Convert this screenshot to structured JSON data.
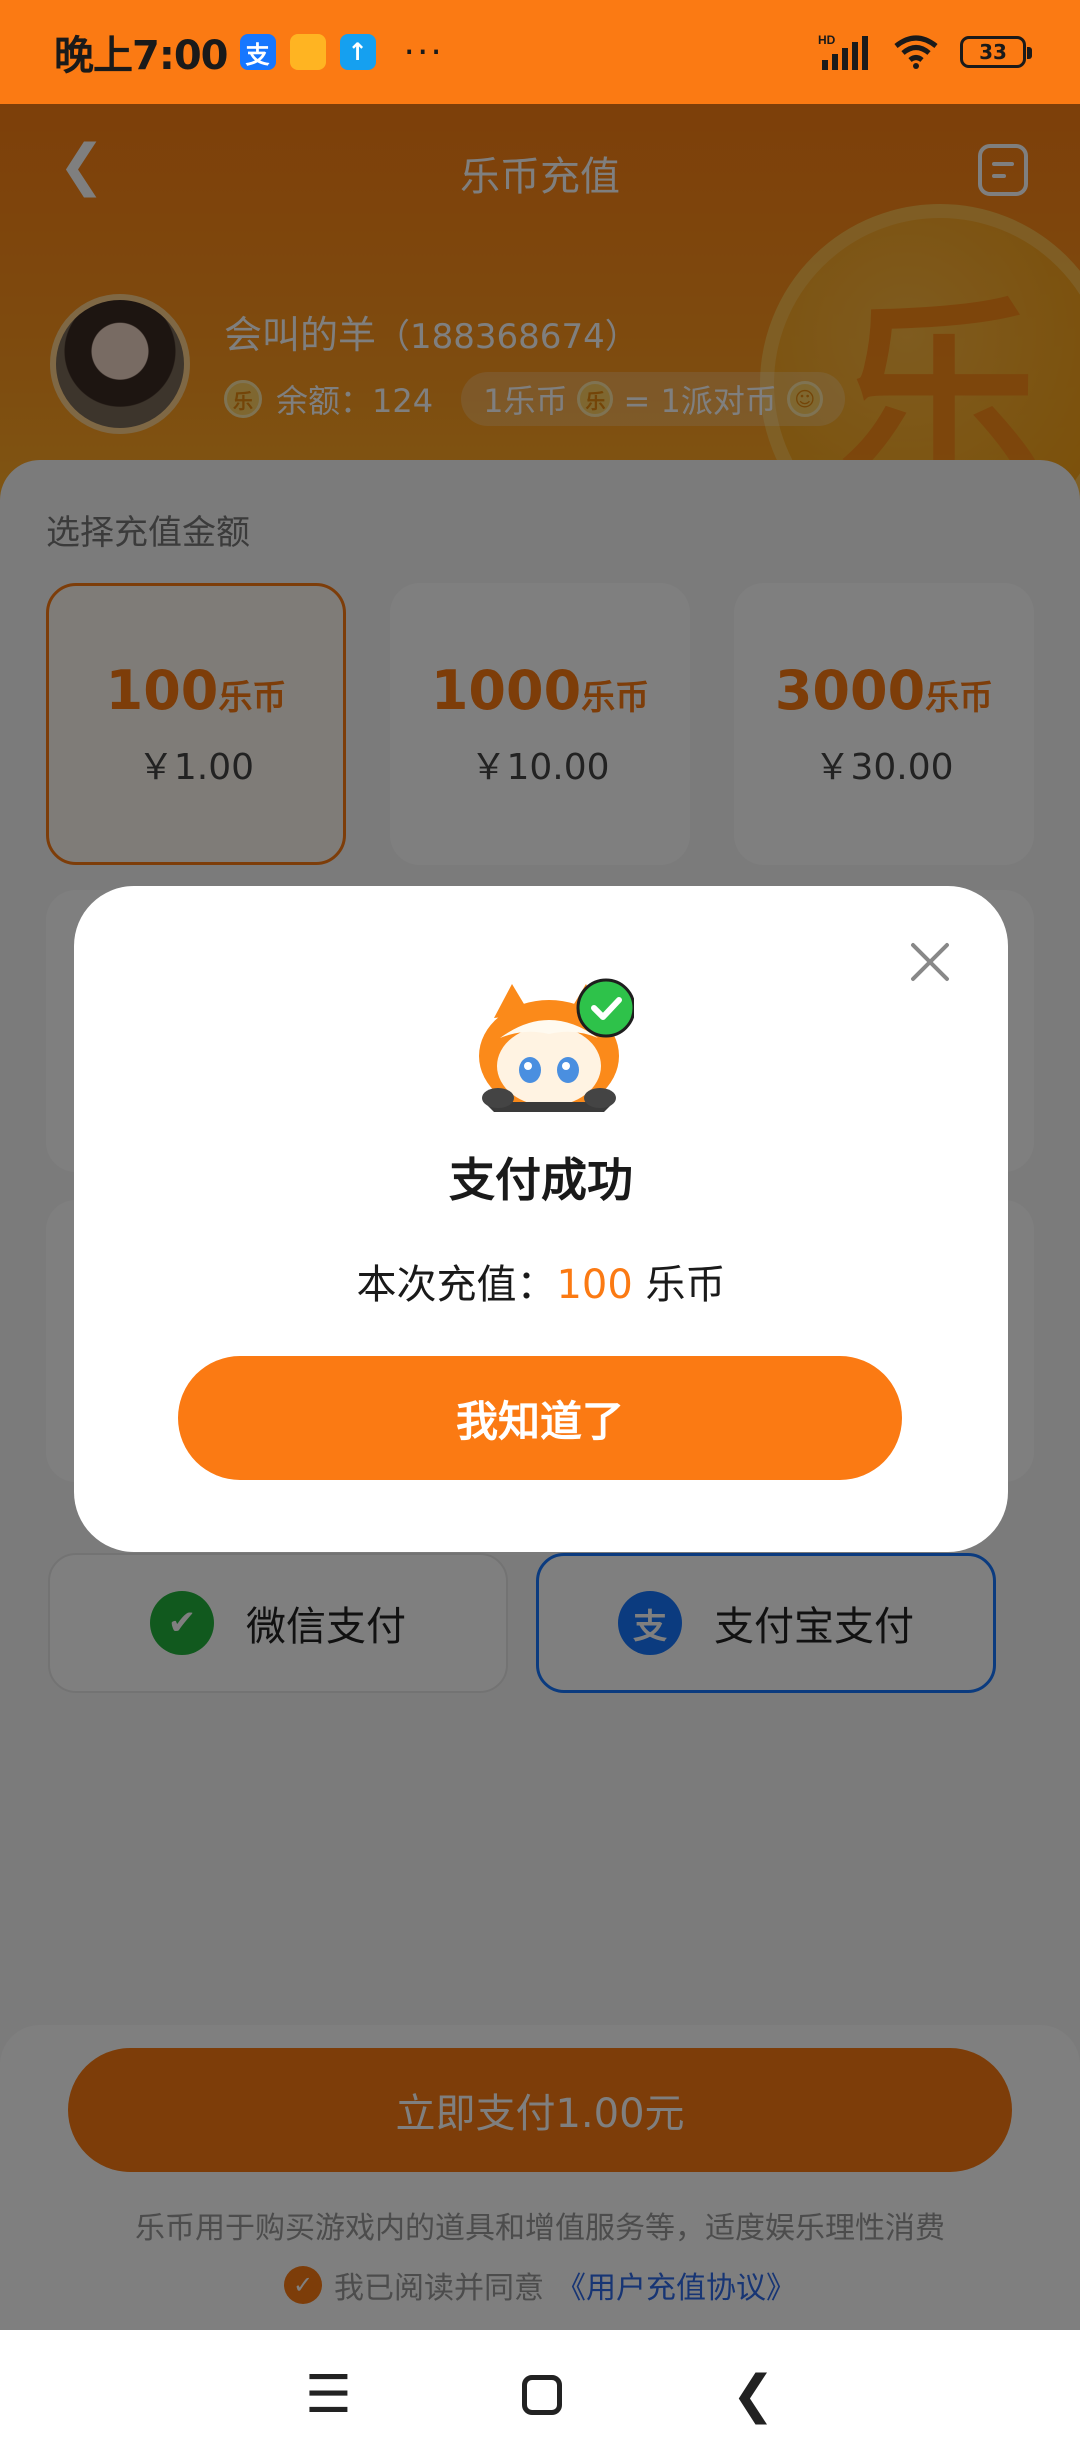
{
  "status_bar": {
    "time": "晚上7:00",
    "apps": [
      "支",
      "",
      "↑"
    ],
    "more": "···",
    "network": "HD",
    "battery": "33"
  },
  "header": {
    "title": "乐币充值",
    "coin_glyph": "乐",
    "user": {
      "name": "会叫的羊",
      "id": "（188368674）"
    },
    "balance_label": "余额：124",
    "rate_left": "1乐币",
    "rate_right": "= 1派对币",
    "coin_icon_text": "乐"
  },
  "recharge": {
    "section_title": "选择充值金额",
    "options": [
      {
        "coins": "100",
        "unit": "乐币",
        "price": "￥1.00"
      },
      {
        "coins": "1000",
        "unit": "乐币",
        "price": "￥10.00"
      },
      {
        "coins": "3000",
        "unit": "乐币",
        "price": "￥30.00"
      }
    ],
    "selected_index": 0
  },
  "payment": {
    "wechat_label": "微信支付",
    "alipay_label": "支付宝支付",
    "alipay_icon_text": "支",
    "selected": "alipay"
  },
  "bottom": {
    "pay_button": "立即支付1.00元",
    "disclaimer": "乐币用于购买游戏内的道具和增值服务等，适度娱乐理性消费",
    "agree_prefix": "我已阅读并同意",
    "agree_link": "《用户充值协议》"
  },
  "modal": {
    "title": "支付成功",
    "line_prefix": "本次充值：",
    "line_amount": "100",
    "line_suffix": " 乐币",
    "button": "我知道了"
  },
  "colors": {
    "brand_orange": "#fb7a13",
    "alipay_blue": "#1677ff",
    "wechat_green": "#23b33c",
    "success_green": "#2ec24a"
  },
  "icons": {
    "back": "back-arrow-icon",
    "record": "record-icon",
    "close": "close-icon",
    "wechat": "wechat-icon",
    "alipay": "alipay-icon",
    "check": "check-icon"
  }
}
